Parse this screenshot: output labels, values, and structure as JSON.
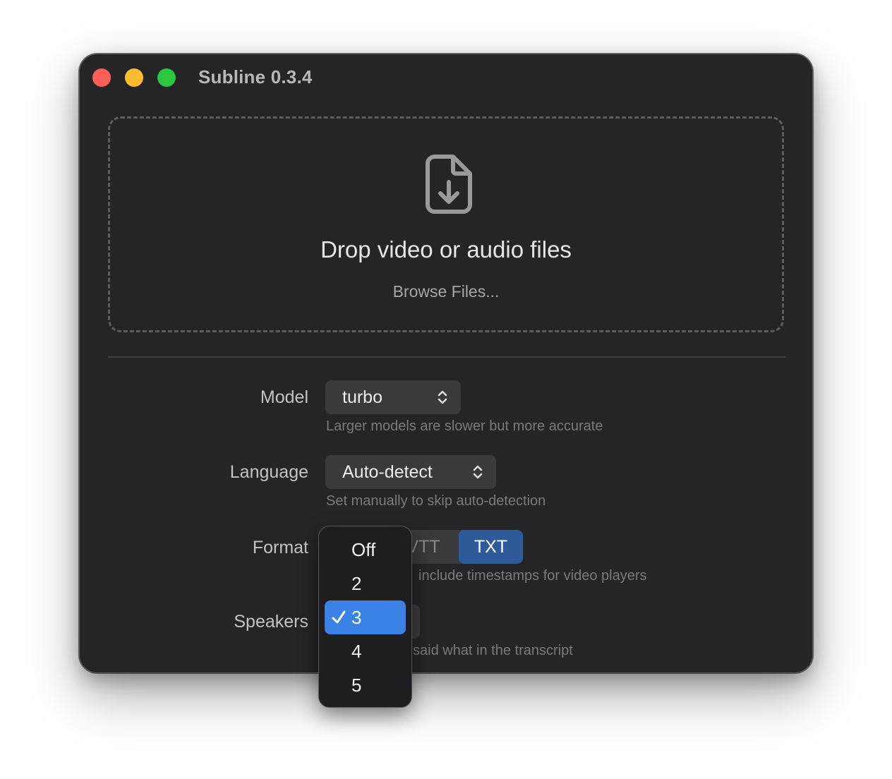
{
  "window": {
    "title": "Subline 0.3.4"
  },
  "dropzone": {
    "title": "Drop video or audio files",
    "browse_label": "Browse Files..."
  },
  "model": {
    "label": "Model",
    "value": "turbo",
    "hint": "Larger models are slower but more accurate"
  },
  "language": {
    "label": "Language",
    "value": "Auto-detect",
    "hint": "Set manually to skip auto-detection"
  },
  "format": {
    "label": "Format",
    "options_visible": [
      "VTT",
      "TXT"
    ],
    "selected": "TXT",
    "hint_visible": "include timestamps for video players"
  },
  "speakers": {
    "label": "Speakers",
    "hint_visible": "said what in the transcript",
    "menu": {
      "items": [
        "Off",
        "2",
        "3",
        "4",
        "5"
      ],
      "selected": "3"
    }
  },
  "colors": {
    "accent": "#3b82e6",
    "segment_selected": "#2f5a9a",
    "background": "#252528"
  },
  "icons": {
    "dropzone": "file-download-icon",
    "popup": "chevron-up-down-icon",
    "menu_check": "checkmark-icon"
  }
}
